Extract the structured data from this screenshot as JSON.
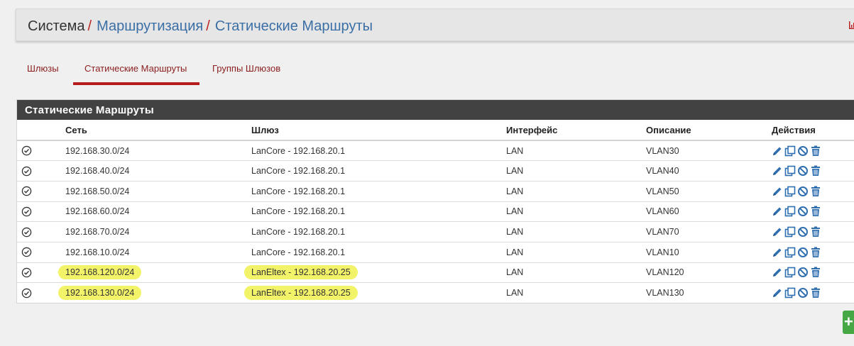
{
  "breadcrumb": {
    "root": "Система",
    "sep1": "/",
    "item1": "Маршрутизация",
    "sep2": "/",
    "item2": "Статические Маршруты"
  },
  "tabs": [
    {
      "label": "Шлюзы",
      "active": false
    },
    {
      "label": "Статические Маршруты",
      "active": true
    },
    {
      "label": "Группы Шлюзов",
      "active": false
    }
  ],
  "panel": {
    "title": "Статические Маршруты",
    "columns": {
      "network": "Сеть",
      "gateway": "Шлюз",
      "interface": "Интерфейс",
      "description": "Описание",
      "actions": "Действия"
    },
    "rows": [
      {
        "network": "192.168.30.0/24",
        "gateway": "LanCore - 192.168.20.1",
        "interface": "LAN",
        "description": "VLAN30",
        "highlighted": false
      },
      {
        "network": "192.168.40.0/24",
        "gateway": "LanCore - 192.168.20.1",
        "interface": "LAN",
        "description": "VLAN40",
        "highlighted": false
      },
      {
        "network": "192.168.50.0/24",
        "gateway": "LanCore - 192.168.20.1",
        "interface": "LAN",
        "description": "VLAN50",
        "highlighted": false
      },
      {
        "network": "192.168.60.0/24",
        "gateway": "LanCore - 192.168.20.1",
        "interface": "LAN",
        "description": "VLAN60",
        "highlighted": false
      },
      {
        "network": "192.168.70.0/24",
        "gateway": "LanCore - 192.168.20.1",
        "interface": "LAN",
        "description": "VLAN70",
        "highlighted": false
      },
      {
        "network": "192.168.10.0/24",
        "gateway": "LanCore - 192.168.20.1",
        "interface": "LAN",
        "description": "VLAN10",
        "highlighted": false
      },
      {
        "network": "192.168.120.0/24",
        "gateway": "LanEltex - 192.168.20.25",
        "interface": "LAN",
        "description": "VLAN120",
        "highlighted": true
      },
      {
        "network": "192.168.130.0/24",
        "gateway": "LanEltex - 192.168.20.25",
        "interface": "LAN",
        "description": "VLAN130",
        "highlighted": true
      }
    ]
  },
  "add_button": {
    "label": "+"
  },
  "colors": {
    "accent": "#b41c1c",
    "link": "#3a6fa6",
    "panel_header": "#424242",
    "action_icon": "#2f6fb0",
    "add_button": "#45a845",
    "highlight": "#f3f36a"
  },
  "icons": {
    "row_status": "check-circle-icon",
    "actions": [
      "pencil-icon",
      "copy-icon",
      "ban-icon",
      "trash-icon"
    ],
    "header_right": "bar-chart-icon"
  }
}
